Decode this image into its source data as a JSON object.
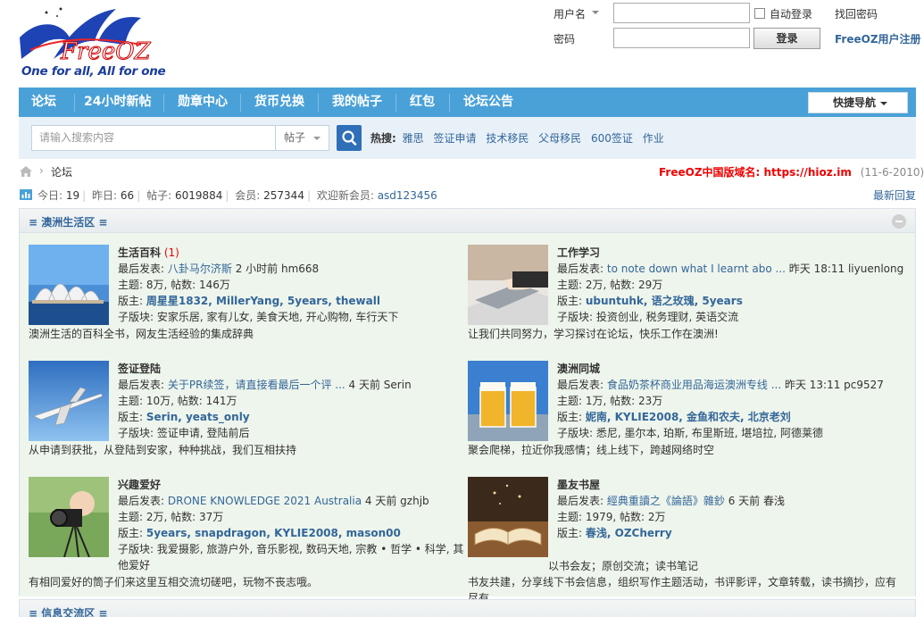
{
  "logo": {
    "name": "FreeOZ",
    "slogan": "One for all, All for one"
  },
  "login": {
    "username_label": "用户名",
    "password_label": "密码",
    "auto_login_label": "自动登录",
    "forgot_password": "找回密码",
    "login_button": "登录",
    "register": "FreeOZ用户注册"
  },
  "nav": {
    "items": [
      "论坛",
      "24小时新帖",
      "勋章中心",
      "货币兑换",
      "我的帖子",
      "红包",
      "论坛公告"
    ],
    "quick_nav": "快捷导航"
  },
  "search": {
    "placeholder": "请输入搜索内容",
    "type": "帖子",
    "hot_label": "热搜:",
    "hot_terms": [
      "雅思",
      "签证申请",
      "技术移民",
      "父母移民",
      "600签证",
      "作业"
    ]
  },
  "breadcrumb": {
    "current": "论坛"
  },
  "domain_notice": {
    "text": "FreeOZ中国版域名:  https://hioz.im",
    "date": "(11-6-2010)"
  },
  "stats": {
    "today_label": "今日:",
    "today": "19",
    "yesterday_label": "昨日:",
    "yesterday": "66",
    "posts_label": "帖子:",
    "posts": "6019884",
    "members_label": "会员:",
    "members": "257344",
    "welcome_label": "欢迎新会员:",
    "newest_member": "asd123456",
    "latest_replies": "最新回复"
  },
  "sections": [
    {
      "title": "≡ 澳洲生活区 ≡"
    },
    {
      "title": "≡ 信息交流区 ≡"
    }
  ],
  "forums": [
    {
      "name": "生活百科",
      "new": "(1)",
      "last_label": "最后发表:",
      "last_title": "八卦马尔济斯",
      "last_meta": "2 小时前 hm668",
      "counts": "主题: 8万, 帖数: 146万",
      "mods_label": "版主:",
      "mods": "周星星1832, MillerYang, 5years, thewall",
      "sub_label": "子版块:",
      "subs": "安家乐居, 家有儿女, 美食天地, 开心购物, 车行天下",
      "desc": "澳洲生活的百科全书，网友生活经验的集成辞典"
    },
    {
      "name": "工作学习",
      "new": "",
      "last_label": "最后发表:",
      "last_title": "to note down what I learnt abo ...",
      "last_meta": "昨天 18:11 liyuenlong",
      "counts": "主题: 2万, 帖数: 29万",
      "mods_label": "版主:",
      "mods": "ubuntuhk, 语之玫瑰, 5years",
      "sub_label": "子版块:",
      "subs": "投资创业, 税务理财, 英语交流",
      "desc": "让我们共同努力，学习探讨在论坛，快乐工作在澳洲!"
    },
    {
      "name": "签证登陆",
      "new": "",
      "last_label": "最后发表:",
      "last_title": "关于PR续签，请直接看最后一个评 ...",
      "last_meta": "4 天前 Serin",
      "counts": "主题: 10万, 帖数: 141万",
      "mods_label": "版主:",
      "mods": "Serin, yeats_only",
      "sub_label": "子版块:",
      "subs": "签证申请, 登陆前后",
      "desc": "从申请到获批，从登陆到安家，种种挑战，我们互相扶持"
    },
    {
      "name": "澳洲同城",
      "new": "",
      "last_label": "最后发表:",
      "last_title": "食品奶茶杯商业用品海运澳洲专线 ...",
      "last_meta": "昨天 13:11 pc9527",
      "counts": "主题: 1万, 帖数: 23万",
      "mods_label": "版主:",
      "mods": "妮南, KYLIE2008, 金鱼和农夫, 北京老刘",
      "sub_label": "子版块:",
      "subs": "悉尼, 墨尔本, 珀斯, 布里斯班, 堪培拉, 阿德莱德",
      "desc": "聚会爬梯，拉近你我感情；线上线下，跨越网络时空"
    },
    {
      "name": "兴趣爱好",
      "new": "",
      "last_label": "最后发表:",
      "last_title": "DRONE KNOWLEDGE 2021 Australia",
      "last_meta": "4 天前 gzhjb",
      "counts": "主题: 2万, 帖数: 37万",
      "mods_label": "版主:",
      "mods": "5years, snapdragon, KYLIE2008, mason00",
      "sub_label": "子版块:",
      "subs": "我爱摄影, 旅游户外, 音乐影视, 数码天地, 宗教 • 哲学 • 科学, 其他爱好",
      "desc": "有相同爱好的筒子们来这里互相交流切磋吧，玩物不丧志哦。"
    },
    {
      "name": "墨友书屋",
      "new": "",
      "last_label": "最后发表:",
      "last_title": "經典重讀之《論語》雜鈔",
      "last_meta": "6 天前 春浅",
      "counts": "主题: 1979, 帖数: 2万",
      "mods_label": "版主:",
      "mods": "春浅, OZCherry",
      "sub_label": "",
      "subs": "以书会友；原创交流；读书笔记",
      "desc": "书友共建，分享线下书会信息，组织写作主题活动，书评影评，文章转载，读书摘抄，应有尽有"
    }
  ]
}
